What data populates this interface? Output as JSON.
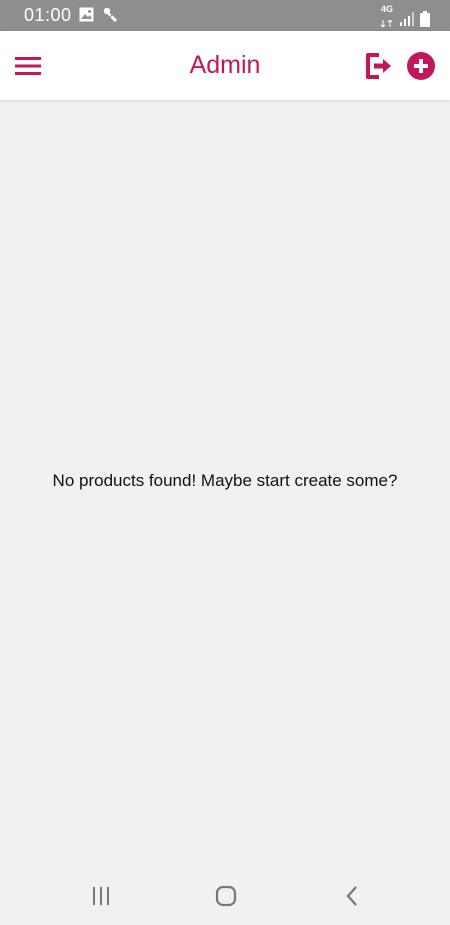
{
  "status_bar": {
    "time": "01:00",
    "network": "4G",
    "icons": [
      "gallery-icon",
      "debug-icon",
      "signal-icon",
      "battery-icon"
    ]
  },
  "app_bar": {
    "title": "Admin",
    "icons": [
      "menu-icon",
      "logout-icon",
      "add-circle-icon"
    ]
  },
  "main": {
    "empty_message": "No products found! Maybe start create some?"
  },
  "nav_bar": {
    "icons": [
      "recent-apps-icon",
      "home-icon",
      "back-icon"
    ]
  },
  "colors": {
    "accent": "#c2185b",
    "status_bar": "#8e8e8e",
    "background": "#f1f1f1",
    "app_bar": "#ffffff"
  }
}
